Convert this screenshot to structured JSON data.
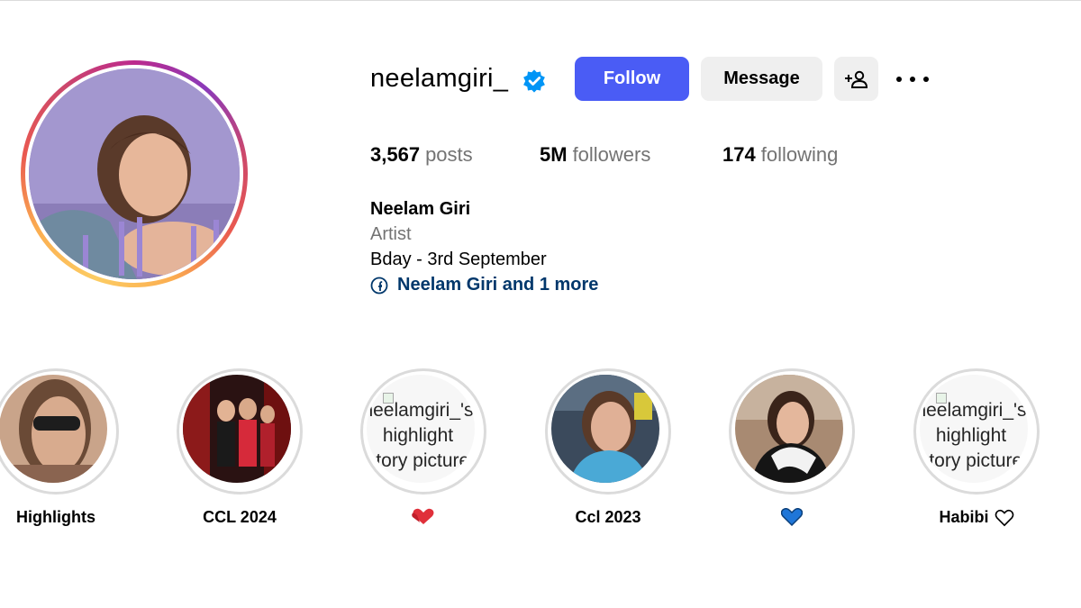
{
  "profile": {
    "username": "neelamgiri_",
    "verified": true,
    "follow_label": "Follow",
    "message_label": "Message",
    "add_user_icon": "add-person-icon",
    "more_icon": "more-options-icon"
  },
  "stats": {
    "posts_value": "3,567",
    "posts_label": "posts",
    "followers_value": "5M",
    "followers_label": "followers",
    "following_value": "174",
    "following_label": "following"
  },
  "bio": {
    "name": "Neelam Giri",
    "category": "Artist",
    "line": "Bday - 3rd September",
    "link_text": "Neelam Giri and 1 more",
    "link_icon": "facebook-icon"
  },
  "highlights": [
    {
      "label": "Highlights",
      "image": "photo"
    },
    {
      "label": "CCL 2024",
      "image": "photo"
    },
    {
      "label": "",
      "label_icon": "red-heart",
      "image": "broken",
      "alt_lines": [
        "neelamgiri_'s",
        "highlight",
        "story picture"
      ]
    },
    {
      "label": "Ccl 2023",
      "image": "photo"
    },
    {
      "label": "",
      "label_icon": "blue-heart",
      "image": "photo"
    },
    {
      "label": "Habibi",
      "label_icon": "outline-heart",
      "image": "broken",
      "alt_lines": [
        "neelamgiri_'s",
        "highlight",
        "story picture"
      ]
    }
  ],
  "colors": {
    "follow_button": "#4a5cf5",
    "secondary_button": "#efefef",
    "verified_badge": "#0095f6",
    "link": "#00376b",
    "muted_text": "#737373"
  }
}
